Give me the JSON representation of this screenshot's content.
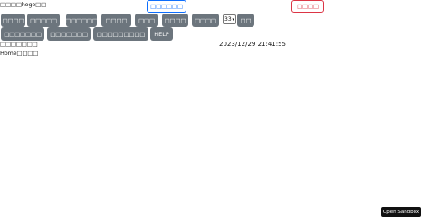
{
  "header": {
    "user_line": "□□□□hoge□□",
    "primary_outline_button": "□□□□□□",
    "danger_outline_button": "□□□□"
  },
  "menu": {
    "row1": [
      "□□□□",
      "□□□□□",
      "□□□□□□",
      "□□□□",
      "□□□",
      "□□□□",
      "□□□□"
    ],
    "row2": [
      "□□□□□□□",
      "□□□□□□□",
      "□□□□□□□□□",
      "HELP"
    ]
  },
  "selector": {
    "value": "33",
    "button_label": "□□"
  },
  "timestamp": "2023/12/29 21:41:55",
  "section_title": "□□□□□□□",
  "breadcrumb": "Home□□□□",
  "sandbox_button": "Open Sandbox",
  "colors": {
    "primary": "#0d6efd",
    "danger": "#dc3545",
    "secondary": "#6c757d"
  }
}
